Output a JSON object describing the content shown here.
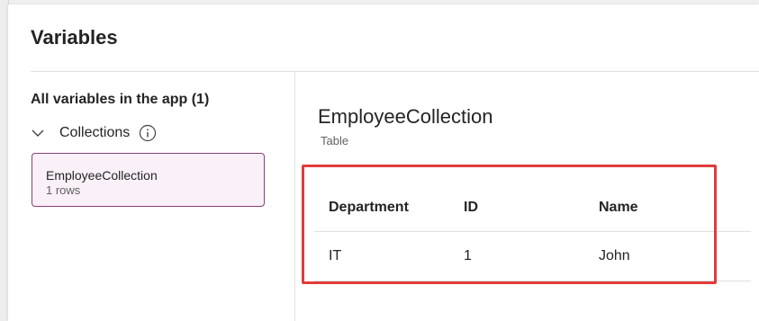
{
  "dialog": {
    "title": "Variables"
  },
  "left_pane": {
    "heading": "All variables in the app (1)",
    "group": {
      "label": "Collections",
      "expanded": true,
      "items": [
        {
          "name": "EmployeeCollection",
          "meta": "1 rows",
          "selected": true
        }
      ]
    }
  },
  "detail": {
    "title": "EmployeeCollection",
    "type": "Table",
    "table": {
      "headers": [
        "Department",
        "ID",
        "Name"
      ],
      "rows": [
        [
          "IT",
          "1",
          "John"
        ]
      ]
    }
  },
  "colors": {
    "selection_fill": "#f9f0f8",
    "selection_border": "#8a3f7d",
    "highlight": "#e03c3c"
  },
  "icons": {
    "expand": "chevron-down-icon",
    "info": "info-icon"
  }
}
